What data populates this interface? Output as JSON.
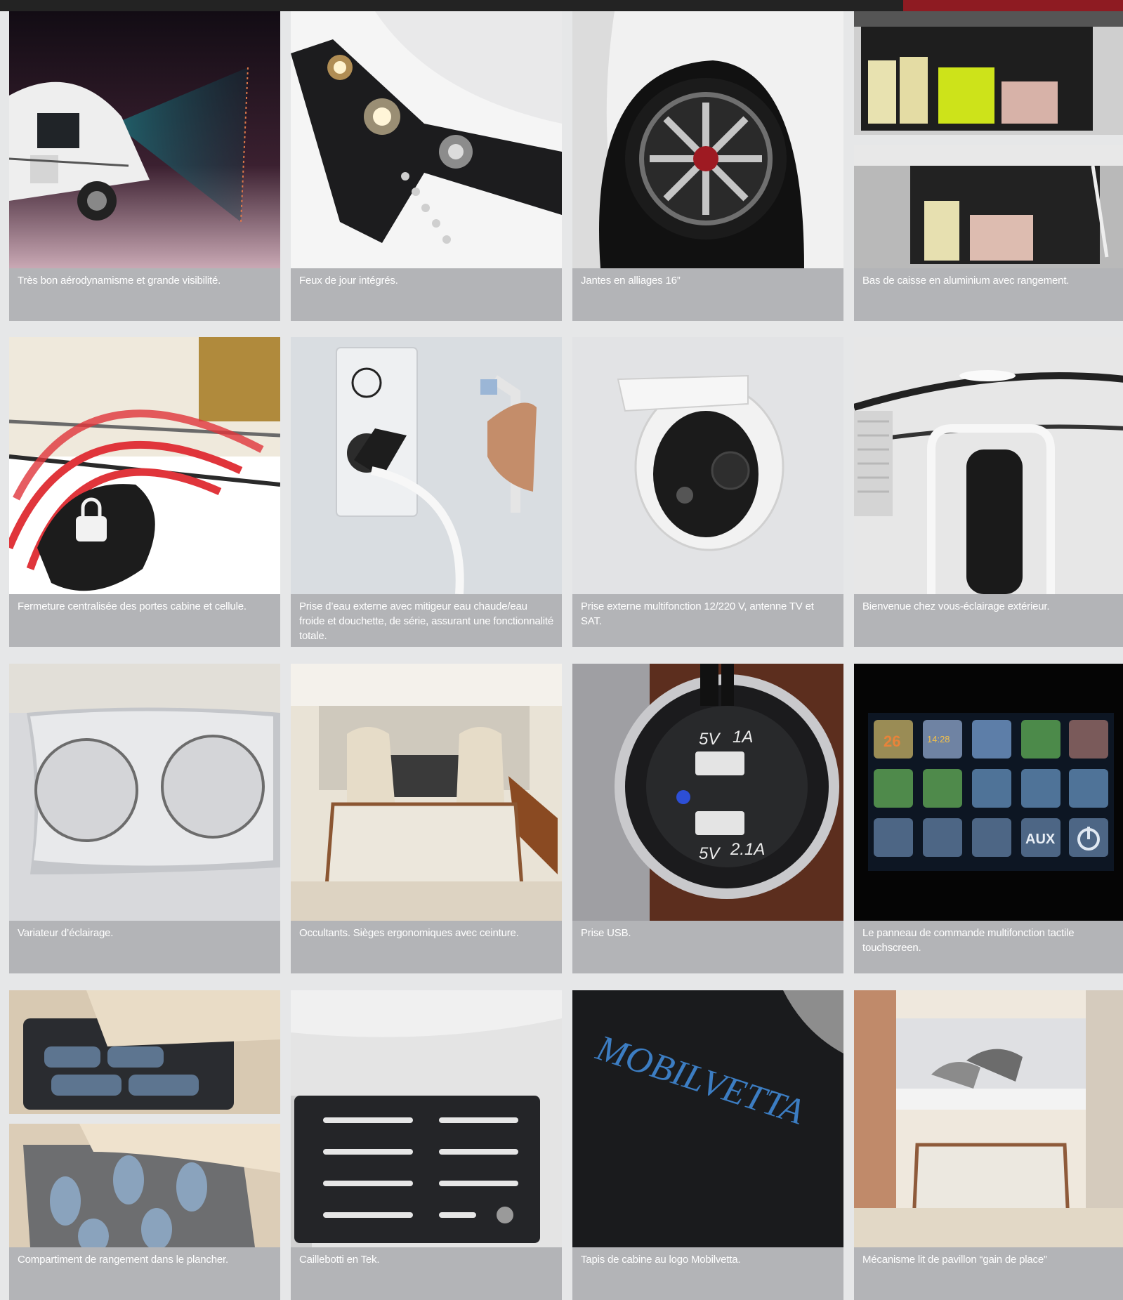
{
  "colors": {
    "background": "#e6e7e8",
    "caption_bg": "#b3b4b7",
    "caption_text": "#ffffff",
    "top_bar": "#232323",
    "accent": "#8e1b22"
  },
  "rows": [
    {
      "items": [
        {
          "caption": "Très bon aérodynamisme et grande visibilité.",
          "icon": "motorhome-aero-image"
        },
        {
          "caption": "Feux de jour intégrés.",
          "icon": "daytime-lights-image"
        },
        {
          "caption": "Jantes en alliages 16”",
          "icon": "alloy-wheel-image"
        },
        {
          "caption": "Bas de caisse en aluminium avec rangement.",
          "icon": "aluminium-storage-image"
        }
      ]
    },
    {
      "items": [
        {
          "caption": "Fermeture centralisée des portes cabine et cellule.",
          "icon": "central-locking-image"
        },
        {
          "caption": "Prise d’eau externe avec mitigeur eau chaude/eau froide et douchette, de série, assurant une fonctionnalité totale.",
          "icon": "water-outlet-image"
        },
        {
          "caption": "Prise externe multifonction 12/220 V, antenne TV et SAT.",
          "icon": "external-socket-image"
        },
        {
          "caption": "Bienvenue chez vous-éclairage extérieur.",
          "icon": "exterior-lighting-image"
        }
      ]
    },
    {
      "items": [
        {
          "caption": "Variateur d’éclairage.",
          "icon": "light-dimmer-image"
        },
        {
          "caption": "Occultants. Sièges ergonomiques avec ceinture.",
          "icon": "cabin-seats-image"
        },
        {
          "caption": "Prise USB.",
          "icon": "usb-socket-image",
          "usb_labels": [
            "5V",
            "1A",
            "5V",
            "2.1A"
          ]
        },
        {
          "caption": "Le panneau de commande multifonction tactile touchscreen.",
          "icon": "touchscreen-panel-image",
          "panel_labels": [
            "26",
            "14:28",
            "AUX"
          ]
        }
      ]
    },
    {
      "items": [
        {
          "caption": "Compartiment de rangement dans le plancher.",
          "icon": "floor-storage-image"
        },
        {
          "caption": "Caillebotti en Tek.",
          "icon": "teak-floor-image"
        },
        {
          "caption": "Tapis de cabine au logo Mobilvetta.",
          "icon": "cabin-mat-image",
          "logo_text": "MOBILVETTA"
        },
        {
          "caption": "Mécanisme lit de pavillon “gain de place”",
          "icon": "pull-down-bed-image"
        }
      ]
    }
  ]
}
